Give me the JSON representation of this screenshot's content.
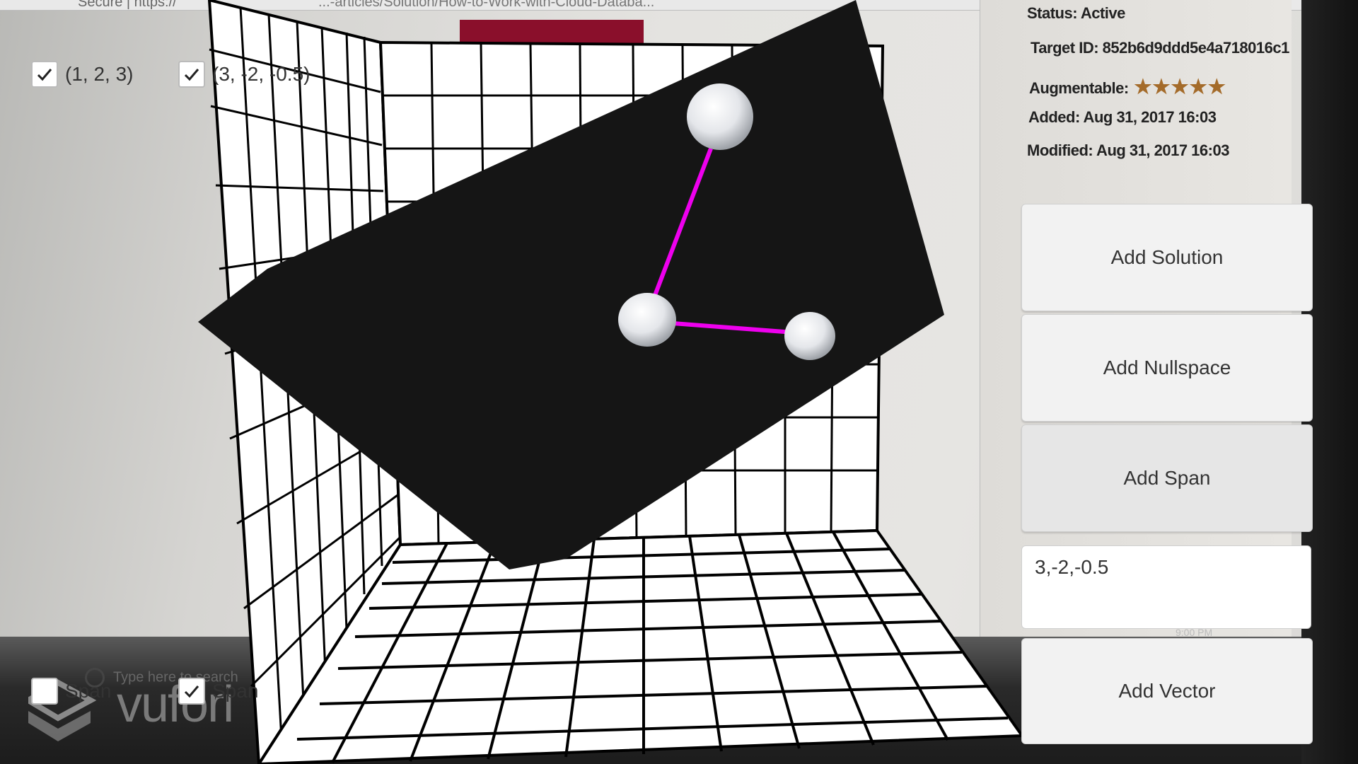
{
  "background": {
    "url_fragment_left": "Secure | https://",
    "url_fragment_right": "...-articles/Solution/How-to-Work-with-Cloud-Databa...",
    "status_line": "Status: Active",
    "target_id": "Target ID: 852b6d9ddd5e4a718016c1",
    "augmentable_label": "Augmentable:",
    "augmentable_stars": "★★★★★",
    "added": "Added: Aug 31, 2017 16:03",
    "modified": "Modified: Aug 31, 2017 16:03",
    "taskbar_search": "Type here to search",
    "logo_text": "vufori",
    "clock": "9:00 PM"
  },
  "vector_toggles": [
    {
      "label": "(1, 2, 3)",
      "checked": true
    },
    {
      "label": "(3, -2, -0.5)",
      "checked": true
    }
  ],
  "span_toggles": [
    {
      "label": "Span",
      "checked": false
    },
    {
      "label": "Span",
      "checked": true
    }
  ],
  "buttons": {
    "add_solution": "Add Solution",
    "add_nullspace": "Add Nullspace",
    "add_span": "Add Span",
    "add_vector": "Add Vector"
  },
  "vector_input": {
    "value": "3,-2,-0.5"
  },
  "colors": {
    "plane": "#151515",
    "vector_line": "#ee00ee",
    "grid_line": "#000000",
    "grid_fill": "#ffffff",
    "button_bg": "#f2f2f2"
  }
}
